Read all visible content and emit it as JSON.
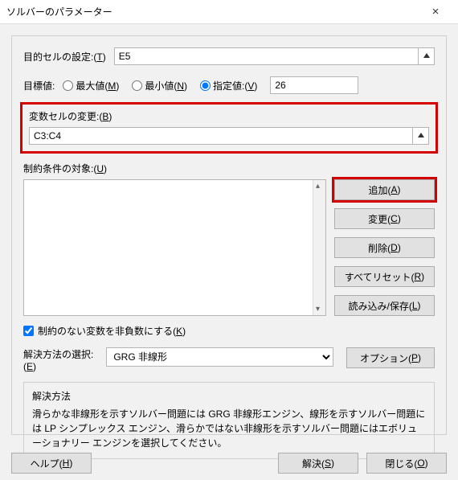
{
  "titlebar": {
    "title": "ソルバーのパラメーター"
  },
  "objective": {
    "label_pre": "目的セルの設定:(",
    "key": "T",
    "label_post": ")",
    "value": "E5"
  },
  "target": {
    "label": "目標値:",
    "max": {
      "pre": "最大値(",
      "key": "M",
      "post": ")"
    },
    "min": {
      "pre": "最小値(",
      "key": "N",
      "post": ")"
    },
    "val": {
      "pre": "指定値:(",
      "key": "V",
      "post": ")"
    },
    "num": "26"
  },
  "changing": {
    "label_pre": "変数セルの変更:(",
    "key": "B",
    "label_post": ")",
    "value": "C3:C4"
  },
  "constraints": {
    "label_pre": "制約条件の対象:(",
    "key": "U",
    "label_post": ")"
  },
  "buttons": {
    "add": {
      "pre": "追加(",
      "key": "A",
      "post": ")"
    },
    "change": {
      "pre": "変更(",
      "key": "C",
      "post": ")"
    },
    "delete": {
      "pre": "削除(",
      "key": "D",
      "post": ")"
    },
    "reset": {
      "pre": "すべてリセット(",
      "key": "R",
      "post": ")"
    },
    "load": {
      "pre": "読み込み/保存(",
      "key": "L",
      "post": ")"
    },
    "options": {
      "pre": "オプション(",
      "key": "P",
      "post": ")"
    }
  },
  "nonneg": {
    "pre": "制約のない変数を非負数にする(",
    "key": "K",
    "post": ")",
    "checked": true
  },
  "method": {
    "label_pre": "解決方法の選択:\n(",
    "key": "E",
    "label_post": ")",
    "selected": "GRG 非線形"
  },
  "info": {
    "head": "解決方法",
    "body": "滑らかな非線形を示すソルバー問題には GRG 非線形エンジン、線形を示すソルバー問題には LP シンプレックス エンジン、滑らかではない非線形を示すソルバー問題にはエボリューショナリー エンジンを選択してください。"
  },
  "footer": {
    "help": {
      "pre": "ヘルプ(",
      "key": "H",
      "post": ")"
    },
    "solve": {
      "pre": "解決(",
      "key": "S",
      "post": ")"
    },
    "close": {
      "pre": "閉じる(",
      "key": "O",
      "post": ")"
    }
  }
}
